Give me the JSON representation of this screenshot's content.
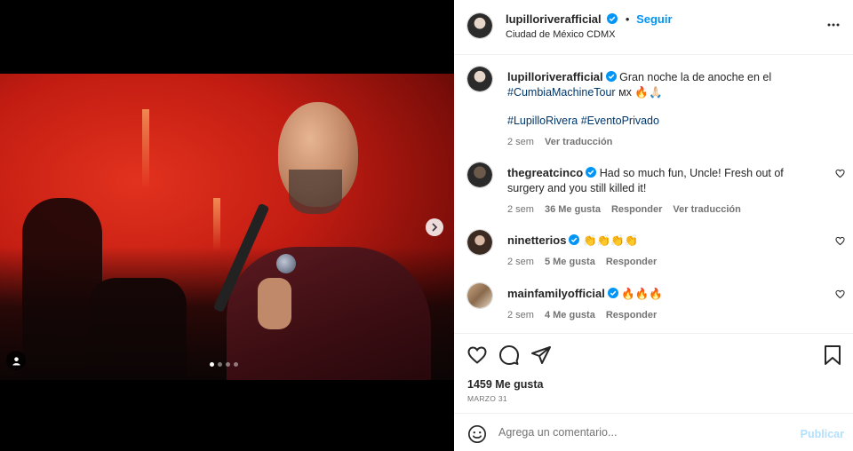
{
  "post": {
    "author": "lupilloriverafficial",
    "follow_label": "Seguir",
    "separator": "•",
    "location": "Ciudad de México CDMX",
    "carousel": {
      "total_slides": 4,
      "active_slide": 1
    }
  },
  "caption": {
    "author": "lupilloriverafficial",
    "text_line1": "Gran noche la de anoche en el",
    "hashtag1": "#CumbiaMachineTour",
    "suffix_emojis": "ᴍx 🔥🙏🏻",
    "hashtag2": "#LupilloRivera",
    "hashtag3": "#EventoPrivado",
    "time": "2 sem",
    "translate": "Ver traducción"
  },
  "comments": [
    {
      "user": "thegreatcinco",
      "text": "Had so much fun, Uncle! Fresh out of surgery and you still killed it!",
      "time": "2 sem",
      "likes": "36 Me gusta",
      "reply": "Responder",
      "translate": "Ver traducción"
    },
    {
      "user": "ninetterios",
      "text": "👏👏👏👏",
      "time": "2 sem",
      "likes": "5 Me gusta",
      "reply": "Responder"
    },
    {
      "user": "mainfamilyofficial",
      "text": "🔥🔥🔥",
      "time": "2 sem",
      "likes": "4 Me gusta",
      "reply": "Responder"
    }
  ],
  "stats": {
    "likes": "1459 Me gusta",
    "date": "MARZO 31"
  },
  "composer": {
    "placeholder": "Agrega un comentario...",
    "publish": "Publicar"
  },
  "colors": {
    "accent": "#0095f6",
    "hashtag": "#00376b",
    "publish_disabled": "#b2dffc",
    "muted": "#737373"
  }
}
